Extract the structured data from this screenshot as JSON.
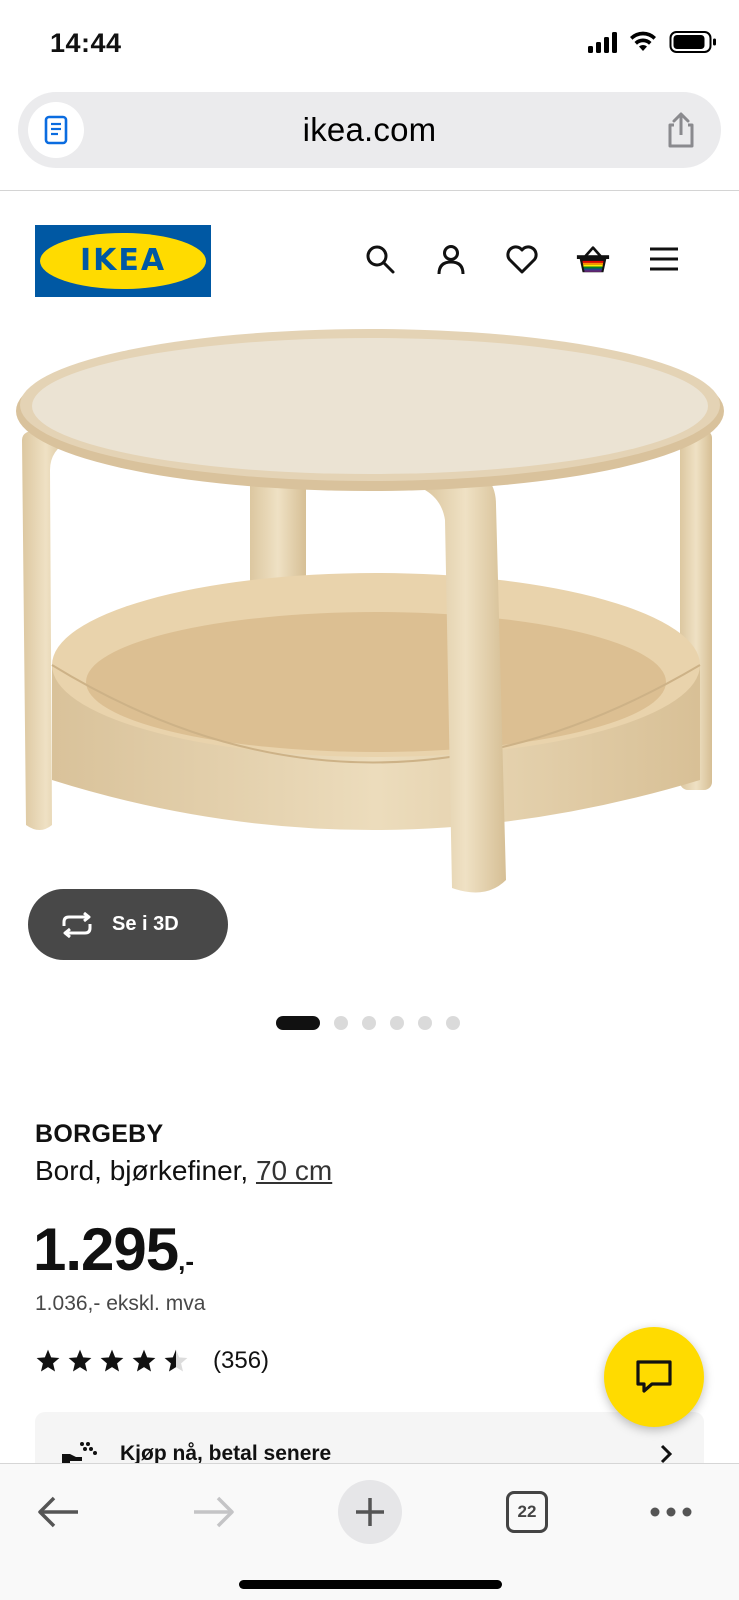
{
  "status_bar": {
    "time": "14:44",
    "icons": [
      "cellular-signal-icon",
      "wifi-icon",
      "battery-icon"
    ]
  },
  "browser": {
    "url": "ikea.com",
    "reader_icon": "reader-page-icon",
    "share_icon": "share-icon"
  },
  "header": {
    "logo_text": "IKEA",
    "icons": [
      "search-icon",
      "account-icon",
      "wishlist-heart-icon",
      "cart-basket-icon",
      "menu-icon"
    ]
  },
  "gallery": {
    "see_3d_label": "Se i 3D",
    "total_images": 6,
    "active_index": 0
  },
  "product": {
    "name": "BORGEBY",
    "description": "Bord, bjørkefiner, ",
    "size_link": "70 cm",
    "price_main": "1.295",
    "price_suffix": ",-",
    "price_ex_vat": "1.036,- ekskl. mva",
    "rating_value": 4.5,
    "rating_max": 5,
    "rating_count": "(356)"
  },
  "payment_card": {
    "label": "Kjøp nå, betal senere"
  },
  "toolbar": {
    "tab_count": "22",
    "icons": [
      "back-arrow-icon",
      "forward-arrow-icon",
      "new-tab-plus-icon",
      "tabs-icon",
      "more-icon"
    ]
  },
  "colors": {
    "ikea_blue": "#0058a3",
    "ikea_yellow": "#ffdb00",
    "see3d_button": "#484848"
  }
}
